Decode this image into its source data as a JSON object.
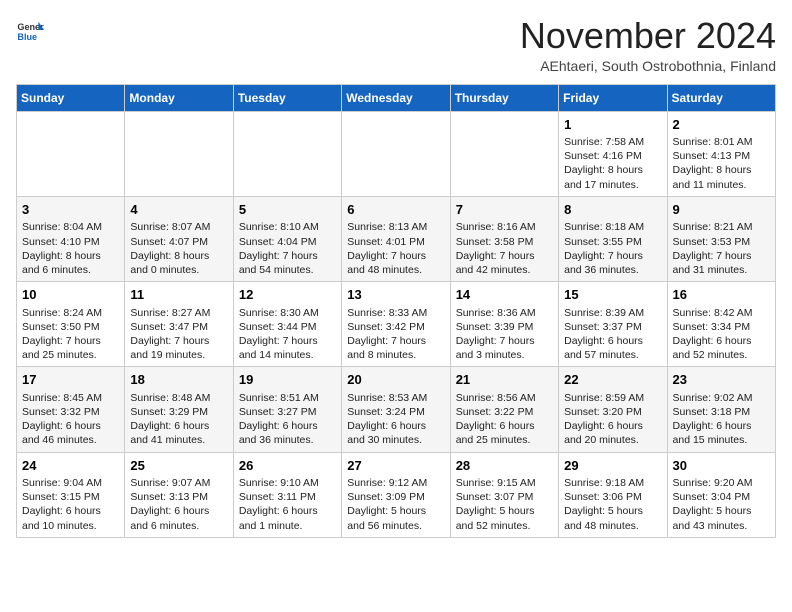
{
  "logo": {
    "general": "General",
    "blue": "Blue"
  },
  "title": "November 2024",
  "location": "AEhtaeri, South Ostrobothnia, Finland",
  "weekdays": [
    "Sunday",
    "Monday",
    "Tuesday",
    "Wednesday",
    "Thursday",
    "Friday",
    "Saturday"
  ],
  "weeks": [
    [
      {
        "day": "",
        "info": ""
      },
      {
        "day": "",
        "info": ""
      },
      {
        "day": "",
        "info": ""
      },
      {
        "day": "",
        "info": ""
      },
      {
        "day": "",
        "info": ""
      },
      {
        "day": "1",
        "info": "Sunrise: 7:58 AM\nSunset: 4:16 PM\nDaylight: 8 hours and 17 minutes."
      },
      {
        "day": "2",
        "info": "Sunrise: 8:01 AM\nSunset: 4:13 PM\nDaylight: 8 hours and 11 minutes."
      }
    ],
    [
      {
        "day": "3",
        "info": "Sunrise: 8:04 AM\nSunset: 4:10 PM\nDaylight: 8 hours and 6 minutes."
      },
      {
        "day": "4",
        "info": "Sunrise: 8:07 AM\nSunset: 4:07 PM\nDaylight: 8 hours and 0 minutes."
      },
      {
        "day": "5",
        "info": "Sunrise: 8:10 AM\nSunset: 4:04 PM\nDaylight: 7 hours and 54 minutes."
      },
      {
        "day": "6",
        "info": "Sunrise: 8:13 AM\nSunset: 4:01 PM\nDaylight: 7 hours and 48 minutes."
      },
      {
        "day": "7",
        "info": "Sunrise: 8:16 AM\nSunset: 3:58 PM\nDaylight: 7 hours and 42 minutes."
      },
      {
        "day": "8",
        "info": "Sunrise: 8:18 AM\nSunset: 3:55 PM\nDaylight: 7 hours and 36 minutes."
      },
      {
        "day": "9",
        "info": "Sunrise: 8:21 AM\nSunset: 3:53 PM\nDaylight: 7 hours and 31 minutes."
      }
    ],
    [
      {
        "day": "10",
        "info": "Sunrise: 8:24 AM\nSunset: 3:50 PM\nDaylight: 7 hours and 25 minutes."
      },
      {
        "day": "11",
        "info": "Sunrise: 8:27 AM\nSunset: 3:47 PM\nDaylight: 7 hours and 19 minutes."
      },
      {
        "day": "12",
        "info": "Sunrise: 8:30 AM\nSunset: 3:44 PM\nDaylight: 7 hours and 14 minutes."
      },
      {
        "day": "13",
        "info": "Sunrise: 8:33 AM\nSunset: 3:42 PM\nDaylight: 7 hours and 8 minutes."
      },
      {
        "day": "14",
        "info": "Sunrise: 8:36 AM\nSunset: 3:39 PM\nDaylight: 7 hours and 3 minutes."
      },
      {
        "day": "15",
        "info": "Sunrise: 8:39 AM\nSunset: 3:37 PM\nDaylight: 6 hours and 57 minutes."
      },
      {
        "day": "16",
        "info": "Sunrise: 8:42 AM\nSunset: 3:34 PM\nDaylight: 6 hours and 52 minutes."
      }
    ],
    [
      {
        "day": "17",
        "info": "Sunrise: 8:45 AM\nSunset: 3:32 PM\nDaylight: 6 hours and 46 minutes."
      },
      {
        "day": "18",
        "info": "Sunrise: 8:48 AM\nSunset: 3:29 PM\nDaylight: 6 hours and 41 minutes."
      },
      {
        "day": "19",
        "info": "Sunrise: 8:51 AM\nSunset: 3:27 PM\nDaylight: 6 hours and 36 minutes."
      },
      {
        "day": "20",
        "info": "Sunrise: 8:53 AM\nSunset: 3:24 PM\nDaylight: 6 hours and 30 minutes."
      },
      {
        "day": "21",
        "info": "Sunrise: 8:56 AM\nSunset: 3:22 PM\nDaylight: 6 hours and 25 minutes."
      },
      {
        "day": "22",
        "info": "Sunrise: 8:59 AM\nSunset: 3:20 PM\nDaylight: 6 hours and 20 minutes."
      },
      {
        "day": "23",
        "info": "Sunrise: 9:02 AM\nSunset: 3:18 PM\nDaylight: 6 hours and 15 minutes."
      }
    ],
    [
      {
        "day": "24",
        "info": "Sunrise: 9:04 AM\nSunset: 3:15 PM\nDaylight: 6 hours and 10 minutes."
      },
      {
        "day": "25",
        "info": "Sunrise: 9:07 AM\nSunset: 3:13 PM\nDaylight: 6 hours and 6 minutes."
      },
      {
        "day": "26",
        "info": "Sunrise: 9:10 AM\nSunset: 3:11 PM\nDaylight: 6 hours and 1 minute."
      },
      {
        "day": "27",
        "info": "Sunrise: 9:12 AM\nSunset: 3:09 PM\nDaylight: 5 hours and 56 minutes."
      },
      {
        "day": "28",
        "info": "Sunrise: 9:15 AM\nSunset: 3:07 PM\nDaylight: 5 hours and 52 minutes."
      },
      {
        "day": "29",
        "info": "Sunrise: 9:18 AM\nSunset: 3:06 PM\nDaylight: 5 hours and 48 minutes."
      },
      {
        "day": "30",
        "info": "Sunrise: 9:20 AM\nSunset: 3:04 PM\nDaylight: 5 hours and 43 minutes."
      }
    ]
  ]
}
